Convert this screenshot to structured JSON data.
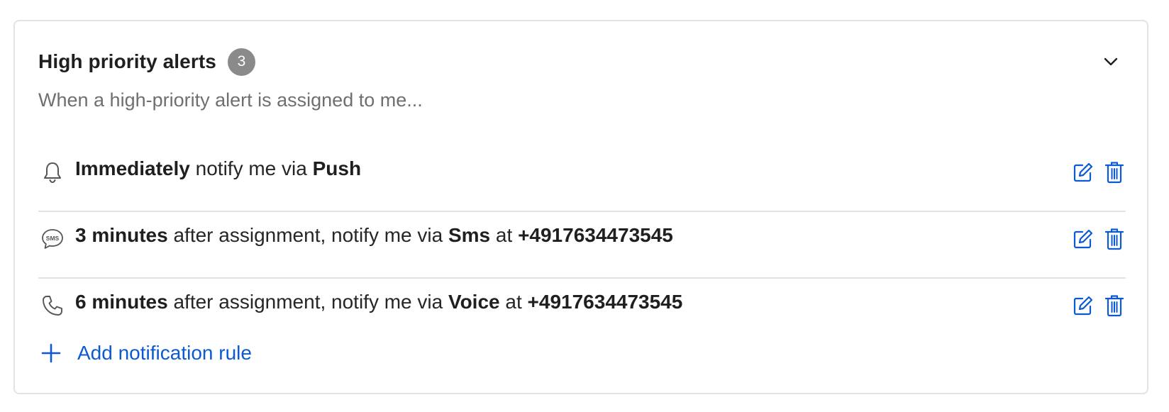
{
  "section": {
    "title": "High priority alerts",
    "count": "3",
    "subtitle": "When a high-priority alert is assigned to me..."
  },
  "rules": [
    {
      "icon": "bell-icon",
      "timing": "Immediately",
      "middle": " notify me via ",
      "channel": "Push",
      "at": "",
      "number": ""
    },
    {
      "icon": "sms-icon",
      "timing": "3 minutes",
      "middle": " after assignment, notify me via ",
      "channel": "Sms",
      "at": " at ",
      "number": "+4917634473545"
    },
    {
      "icon": "phone-icon",
      "timing": "6 minutes",
      "middle": " after assignment, notify me via ",
      "channel": "Voice",
      "at": " at ",
      "number": "+4917634473545"
    }
  ],
  "add_rule": {
    "label": "Add notification rule"
  },
  "colors": {
    "accent": "#0b5ad4",
    "badge": "#8a8a8a",
    "divider": "#e3e3e3",
    "muted_text": "#6f6f6f"
  }
}
